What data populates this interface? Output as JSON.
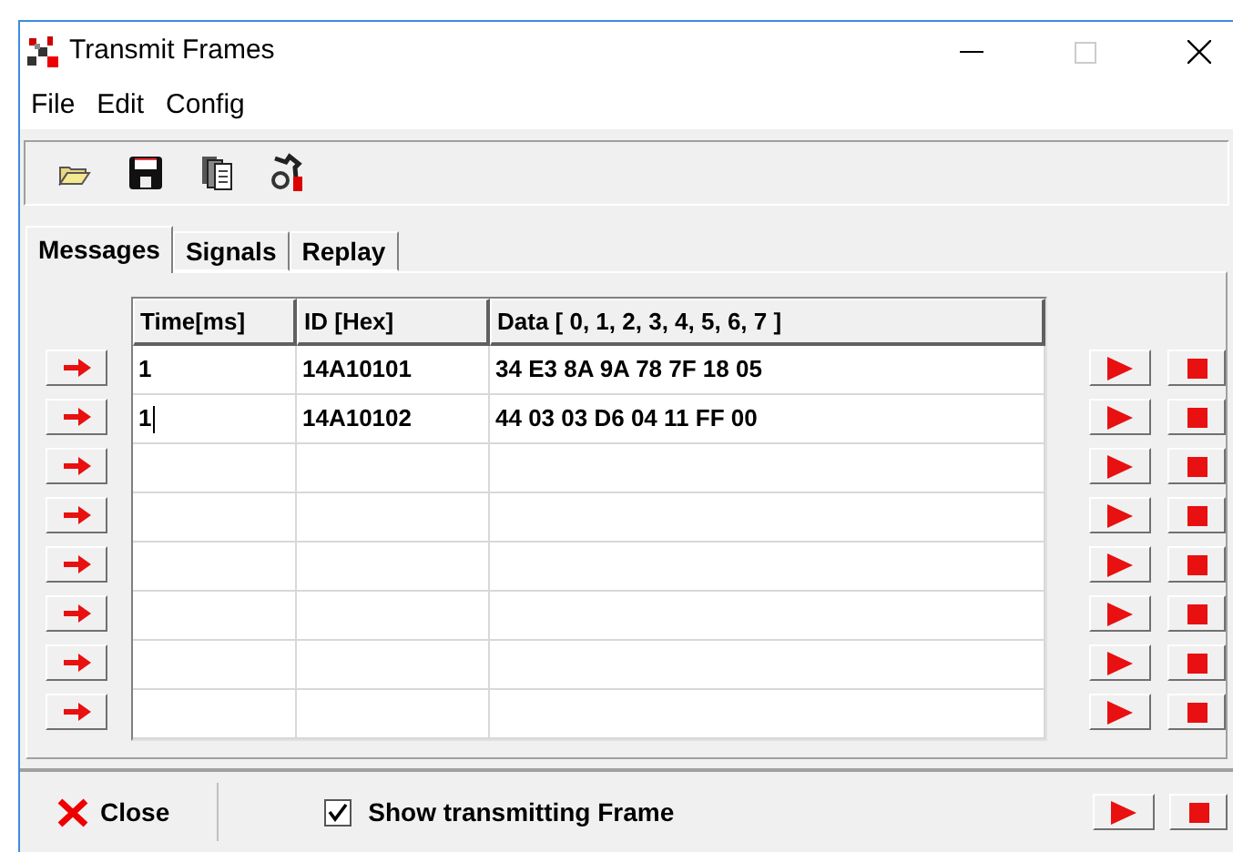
{
  "window": {
    "title": "Transmit Frames"
  },
  "menu": [
    {
      "label": "File"
    },
    {
      "label": "Edit"
    },
    {
      "label": "Config"
    }
  ],
  "tabs": [
    {
      "label": "Messages",
      "selected": true
    },
    {
      "label": "Signals",
      "selected": false
    },
    {
      "label": "Replay",
      "selected": false
    }
  ],
  "table": {
    "columns": [
      "Time[ms]",
      "ID [Hex]",
      "Data [ 0, 1, 2, 3, 4, 5, 6, 7 ]"
    ],
    "rows": [
      {
        "time": "1",
        "id": "14A10101",
        "data": "34 E3 8A 9A 78 7F 18 05",
        "editing": false
      },
      {
        "time": "1",
        "id": "14A10102",
        "data": "44 03 03 D6 04 11 FF 00",
        "editing": true
      },
      {
        "editing": false
      },
      {
        "editing": false
      },
      {
        "editing": false
      },
      {
        "editing": false
      },
      {
        "editing": false
      },
      {
        "editing": false
      }
    ]
  },
  "bottom_bar": {
    "close": "Close",
    "show_transmitting": {
      "label": "Show transmitting Frame",
      "checked": true
    }
  }
}
